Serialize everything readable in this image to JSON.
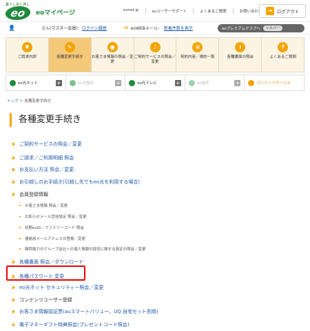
{
  "header": {
    "logo_tagline": "暮らしあと押し",
    "logo_text": "eo",
    "site_name": "eoマイページ",
    "links": [
      "eonet.jp",
      "eoユーザーサポート",
      "よくあるご質問",
      "お問い合わせ"
    ],
    "logout_label": "ログアウト"
  },
  "userbar": {
    "name_prefix": "さん(マスター会員)",
    "login_history": "ログイン履歴",
    "mail_label": "eoWEBメール：",
    "mail_link": "新着件数を表示",
    "premium_label": "eoプレミアムクラブへ",
    "premium_rank": "シルバー"
  },
  "top_nav": [
    {
      "icon": "¥",
      "label": "ご請求内訳",
      "active": false
    },
    {
      "icon": "✎",
      "label": "各種変更手続き",
      "active": true
    },
    {
      "icon": "●",
      "label": "お客さま情報の照会／変更",
      "active": false
    },
    {
      "icon": "♪",
      "label": "ご契約サービスの照会／変更",
      "active": false
    },
    {
      "icon": "≡",
      "label": "契約内容／規約一覧",
      "active": false
    },
    {
      "icon": "i",
      "label": "各種書面の照会",
      "active": false
    },
    {
      "icon": "?",
      "label": "よくあるご質問",
      "active": false
    }
  ],
  "service_nav": [
    {
      "label": "eo光ネット",
      "color": "#1f8a3b",
      "dim": false
    },
    {
      "label": "eo光電話",
      "color": "#7cc28a",
      "dim": true
    },
    {
      "label": "eo光テレビ",
      "color": "#1f8a3b",
      "dim": false
    },
    {
      "label": "eo電気",
      "color": "#9fd2ac",
      "dim": true
    },
    {
      "label": "コンテンツサービス",
      "color": "#f5a300",
      "dim": false
    }
  ],
  "breadcrumb": {
    "home": "トップ",
    "current": "各種変更手続き"
  },
  "page_title": "各種変更手続き",
  "procedures": [
    {
      "label": "ご契約サービスの照会／変更",
      "type": "link"
    },
    {
      "label": "ご請求／ご利用明細 照会",
      "type": "link"
    },
    {
      "label": "お支払い方法 照会／変更",
      "type": "link"
    },
    {
      "label": "お引越しのお手続き(引越し先でもeo光を利用する場合)",
      "type": "link"
    },
    {
      "label": "会員登録情報",
      "type": "plain"
    },
    {
      "label": "お客さま情報 照会／変更",
      "type": "sub"
    },
    {
      "label": "お知らせメール受信設定 照会／変更",
      "type": "sub"
    },
    {
      "label": "初期eoID／ファミリーコード 照会",
      "type": "sub"
    },
    {
      "label": "連絡用メールアドレスの登録／変更",
      "type": "sub"
    },
    {
      "label": "関西電力のグループ会社への個人情報の提供に関する設定の照会／変更",
      "type": "sub"
    },
    {
      "label": "各種書面 照会／ダウンロード",
      "type": "link"
    },
    {
      "label": "各種パスワード 変更",
      "type": "link"
    },
    {
      "label": "eo光ネット セキュリティー照会／変更",
      "type": "link"
    },
    {
      "label": "コンテンツユーザー登録",
      "type": "plain"
    },
    {
      "label": "お客さま情報認証票(auスマートバリュー、UQ 自宅セット割用)",
      "type": "link"
    },
    {
      "label": "電子マネーギフト特典照会(プレゼントコード照会)",
      "type": "link"
    }
  ]
}
